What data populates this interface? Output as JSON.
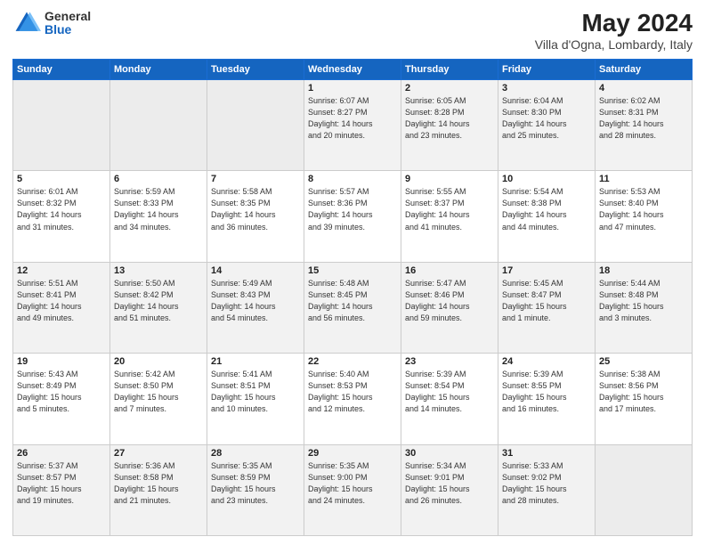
{
  "logo": {
    "line1": "General",
    "line2": "Blue"
  },
  "title": "May 2024",
  "subtitle": "Villa d'Ogna, Lombardy, Italy",
  "weekdays": [
    "Sunday",
    "Monday",
    "Tuesday",
    "Wednesday",
    "Thursday",
    "Friday",
    "Saturday"
  ],
  "weeks": [
    [
      {
        "day": "",
        "info": ""
      },
      {
        "day": "",
        "info": ""
      },
      {
        "day": "",
        "info": ""
      },
      {
        "day": "1",
        "info": "Sunrise: 6:07 AM\nSunset: 8:27 PM\nDaylight: 14 hours\nand 20 minutes."
      },
      {
        "day": "2",
        "info": "Sunrise: 6:05 AM\nSunset: 8:28 PM\nDaylight: 14 hours\nand 23 minutes."
      },
      {
        "day": "3",
        "info": "Sunrise: 6:04 AM\nSunset: 8:30 PM\nDaylight: 14 hours\nand 25 minutes."
      },
      {
        "day": "4",
        "info": "Sunrise: 6:02 AM\nSunset: 8:31 PM\nDaylight: 14 hours\nand 28 minutes."
      }
    ],
    [
      {
        "day": "5",
        "info": "Sunrise: 6:01 AM\nSunset: 8:32 PM\nDaylight: 14 hours\nand 31 minutes."
      },
      {
        "day": "6",
        "info": "Sunrise: 5:59 AM\nSunset: 8:33 PM\nDaylight: 14 hours\nand 34 minutes."
      },
      {
        "day": "7",
        "info": "Sunrise: 5:58 AM\nSunset: 8:35 PM\nDaylight: 14 hours\nand 36 minutes."
      },
      {
        "day": "8",
        "info": "Sunrise: 5:57 AM\nSunset: 8:36 PM\nDaylight: 14 hours\nand 39 minutes."
      },
      {
        "day": "9",
        "info": "Sunrise: 5:55 AM\nSunset: 8:37 PM\nDaylight: 14 hours\nand 41 minutes."
      },
      {
        "day": "10",
        "info": "Sunrise: 5:54 AM\nSunset: 8:38 PM\nDaylight: 14 hours\nand 44 minutes."
      },
      {
        "day": "11",
        "info": "Sunrise: 5:53 AM\nSunset: 8:40 PM\nDaylight: 14 hours\nand 47 minutes."
      }
    ],
    [
      {
        "day": "12",
        "info": "Sunrise: 5:51 AM\nSunset: 8:41 PM\nDaylight: 14 hours\nand 49 minutes."
      },
      {
        "day": "13",
        "info": "Sunrise: 5:50 AM\nSunset: 8:42 PM\nDaylight: 14 hours\nand 51 minutes."
      },
      {
        "day": "14",
        "info": "Sunrise: 5:49 AM\nSunset: 8:43 PM\nDaylight: 14 hours\nand 54 minutes."
      },
      {
        "day": "15",
        "info": "Sunrise: 5:48 AM\nSunset: 8:45 PM\nDaylight: 14 hours\nand 56 minutes."
      },
      {
        "day": "16",
        "info": "Sunrise: 5:47 AM\nSunset: 8:46 PM\nDaylight: 14 hours\nand 59 minutes."
      },
      {
        "day": "17",
        "info": "Sunrise: 5:45 AM\nSunset: 8:47 PM\nDaylight: 15 hours\nand 1 minute."
      },
      {
        "day": "18",
        "info": "Sunrise: 5:44 AM\nSunset: 8:48 PM\nDaylight: 15 hours\nand 3 minutes."
      }
    ],
    [
      {
        "day": "19",
        "info": "Sunrise: 5:43 AM\nSunset: 8:49 PM\nDaylight: 15 hours\nand 5 minutes."
      },
      {
        "day": "20",
        "info": "Sunrise: 5:42 AM\nSunset: 8:50 PM\nDaylight: 15 hours\nand 7 minutes."
      },
      {
        "day": "21",
        "info": "Sunrise: 5:41 AM\nSunset: 8:51 PM\nDaylight: 15 hours\nand 10 minutes."
      },
      {
        "day": "22",
        "info": "Sunrise: 5:40 AM\nSunset: 8:53 PM\nDaylight: 15 hours\nand 12 minutes."
      },
      {
        "day": "23",
        "info": "Sunrise: 5:39 AM\nSunset: 8:54 PM\nDaylight: 15 hours\nand 14 minutes."
      },
      {
        "day": "24",
        "info": "Sunrise: 5:39 AM\nSunset: 8:55 PM\nDaylight: 15 hours\nand 16 minutes."
      },
      {
        "day": "25",
        "info": "Sunrise: 5:38 AM\nSunset: 8:56 PM\nDaylight: 15 hours\nand 17 minutes."
      }
    ],
    [
      {
        "day": "26",
        "info": "Sunrise: 5:37 AM\nSunset: 8:57 PM\nDaylight: 15 hours\nand 19 minutes."
      },
      {
        "day": "27",
        "info": "Sunrise: 5:36 AM\nSunset: 8:58 PM\nDaylight: 15 hours\nand 21 minutes."
      },
      {
        "day": "28",
        "info": "Sunrise: 5:35 AM\nSunset: 8:59 PM\nDaylight: 15 hours\nand 23 minutes."
      },
      {
        "day": "29",
        "info": "Sunrise: 5:35 AM\nSunset: 9:00 PM\nDaylight: 15 hours\nand 24 minutes."
      },
      {
        "day": "30",
        "info": "Sunrise: 5:34 AM\nSunset: 9:01 PM\nDaylight: 15 hours\nand 26 minutes."
      },
      {
        "day": "31",
        "info": "Sunrise: 5:33 AM\nSunset: 9:02 PM\nDaylight: 15 hours\nand 28 minutes."
      },
      {
        "day": "",
        "info": ""
      }
    ]
  ]
}
